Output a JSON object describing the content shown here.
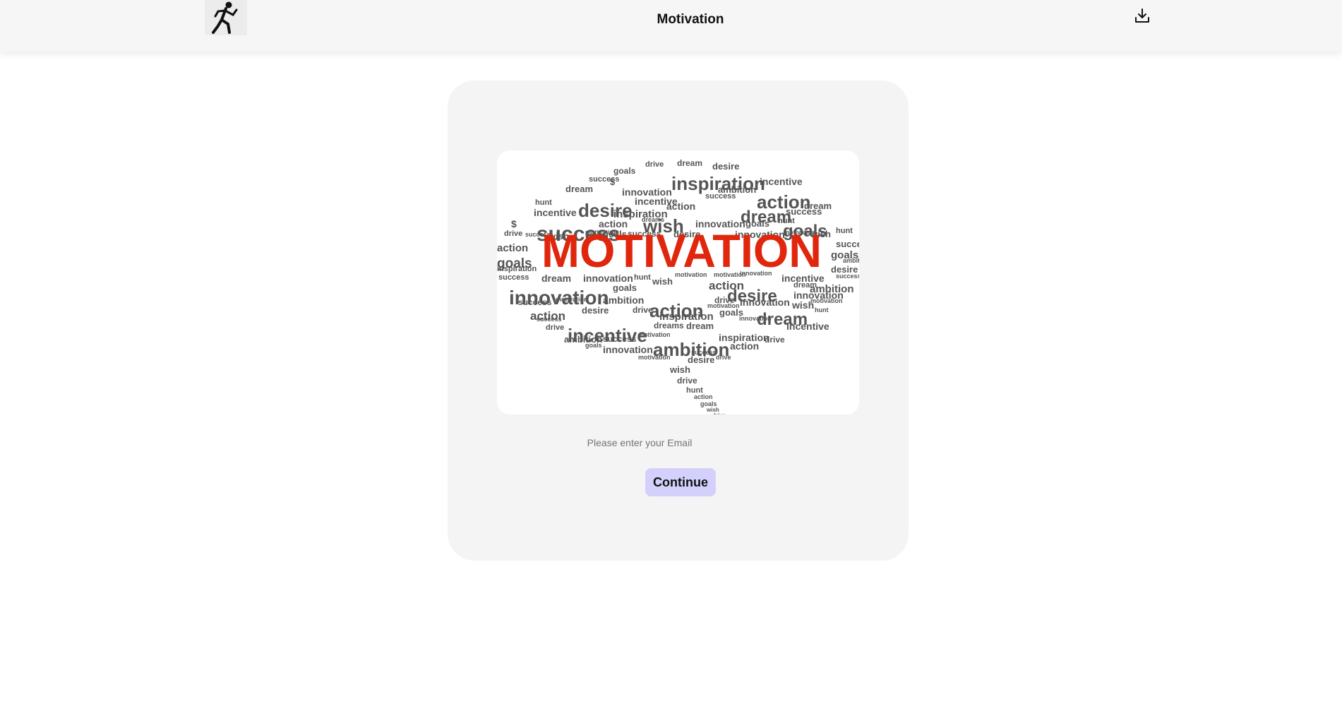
{
  "header": {
    "title": "Motivation",
    "logo_icon": "running-man-icon",
    "download_icon": "download-icon"
  },
  "hero": {
    "main_word": "MOTIVATION",
    "main_word_color": "#e0260c",
    "words_color": "#555555",
    "cloud_words": [
      "drive",
      "dream",
      "desire",
      "goals",
      "inspiration",
      "incentive",
      "success",
      "$",
      "innovation",
      "ambition",
      "action",
      "wish",
      "hunt",
      "dreams",
      "motivation"
    ]
  },
  "form": {
    "email_placeholder": "Please enter your Email",
    "continue_label": "Continue",
    "continue_color": "#d3d1fb"
  }
}
